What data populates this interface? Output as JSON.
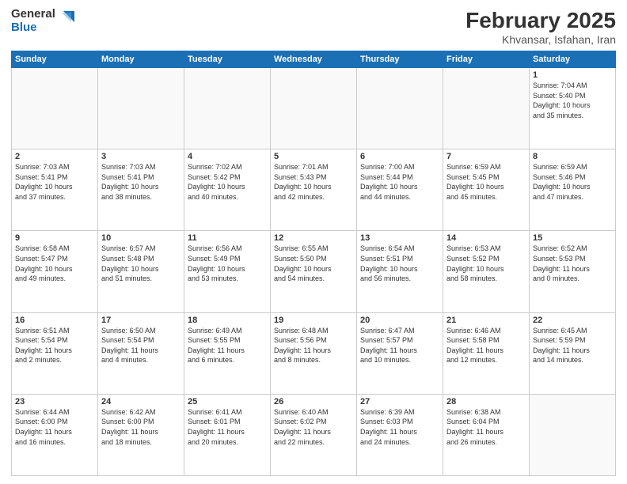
{
  "header": {
    "logo_line1": "General",
    "logo_line2": "Blue",
    "month": "February 2025",
    "location": "Khvansar, Isfahan, Iran"
  },
  "weekdays": [
    "Sunday",
    "Monday",
    "Tuesday",
    "Wednesday",
    "Thursday",
    "Friday",
    "Saturday"
  ],
  "weeks": [
    [
      {
        "day": "",
        "info": ""
      },
      {
        "day": "",
        "info": ""
      },
      {
        "day": "",
        "info": ""
      },
      {
        "day": "",
        "info": ""
      },
      {
        "day": "",
        "info": ""
      },
      {
        "day": "",
        "info": ""
      },
      {
        "day": "1",
        "info": "Sunrise: 7:04 AM\nSunset: 5:40 PM\nDaylight: 10 hours\nand 35 minutes."
      }
    ],
    [
      {
        "day": "2",
        "info": "Sunrise: 7:03 AM\nSunset: 5:41 PM\nDaylight: 10 hours\nand 37 minutes."
      },
      {
        "day": "3",
        "info": "Sunrise: 7:03 AM\nSunset: 5:41 PM\nDaylight: 10 hours\nand 38 minutes."
      },
      {
        "day": "4",
        "info": "Sunrise: 7:02 AM\nSunset: 5:42 PM\nDaylight: 10 hours\nand 40 minutes."
      },
      {
        "day": "5",
        "info": "Sunrise: 7:01 AM\nSunset: 5:43 PM\nDaylight: 10 hours\nand 42 minutes."
      },
      {
        "day": "6",
        "info": "Sunrise: 7:00 AM\nSunset: 5:44 PM\nDaylight: 10 hours\nand 44 minutes."
      },
      {
        "day": "7",
        "info": "Sunrise: 6:59 AM\nSunset: 5:45 PM\nDaylight: 10 hours\nand 45 minutes."
      },
      {
        "day": "8",
        "info": "Sunrise: 6:59 AM\nSunset: 5:46 PM\nDaylight: 10 hours\nand 47 minutes."
      }
    ],
    [
      {
        "day": "9",
        "info": "Sunrise: 6:58 AM\nSunset: 5:47 PM\nDaylight: 10 hours\nand 49 minutes."
      },
      {
        "day": "10",
        "info": "Sunrise: 6:57 AM\nSunset: 5:48 PM\nDaylight: 10 hours\nand 51 minutes."
      },
      {
        "day": "11",
        "info": "Sunrise: 6:56 AM\nSunset: 5:49 PM\nDaylight: 10 hours\nand 53 minutes."
      },
      {
        "day": "12",
        "info": "Sunrise: 6:55 AM\nSunset: 5:50 PM\nDaylight: 10 hours\nand 54 minutes."
      },
      {
        "day": "13",
        "info": "Sunrise: 6:54 AM\nSunset: 5:51 PM\nDaylight: 10 hours\nand 56 minutes."
      },
      {
        "day": "14",
        "info": "Sunrise: 6:53 AM\nSunset: 5:52 PM\nDaylight: 10 hours\nand 58 minutes."
      },
      {
        "day": "15",
        "info": "Sunrise: 6:52 AM\nSunset: 5:53 PM\nDaylight: 11 hours\nand 0 minutes."
      }
    ],
    [
      {
        "day": "16",
        "info": "Sunrise: 6:51 AM\nSunset: 5:54 PM\nDaylight: 11 hours\nand 2 minutes."
      },
      {
        "day": "17",
        "info": "Sunrise: 6:50 AM\nSunset: 5:54 PM\nDaylight: 11 hours\nand 4 minutes."
      },
      {
        "day": "18",
        "info": "Sunrise: 6:49 AM\nSunset: 5:55 PM\nDaylight: 11 hours\nand 6 minutes."
      },
      {
        "day": "19",
        "info": "Sunrise: 6:48 AM\nSunset: 5:56 PM\nDaylight: 11 hours\nand 8 minutes."
      },
      {
        "day": "20",
        "info": "Sunrise: 6:47 AM\nSunset: 5:57 PM\nDaylight: 11 hours\nand 10 minutes."
      },
      {
        "day": "21",
        "info": "Sunrise: 6:46 AM\nSunset: 5:58 PM\nDaylight: 11 hours\nand 12 minutes."
      },
      {
        "day": "22",
        "info": "Sunrise: 6:45 AM\nSunset: 5:59 PM\nDaylight: 11 hours\nand 14 minutes."
      }
    ],
    [
      {
        "day": "23",
        "info": "Sunrise: 6:44 AM\nSunset: 6:00 PM\nDaylight: 11 hours\nand 16 minutes."
      },
      {
        "day": "24",
        "info": "Sunrise: 6:42 AM\nSunset: 6:00 PM\nDaylight: 11 hours\nand 18 minutes."
      },
      {
        "day": "25",
        "info": "Sunrise: 6:41 AM\nSunset: 6:01 PM\nDaylight: 11 hours\nand 20 minutes."
      },
      {
        "day": "26",
        "info": "Sunrise: 6:40 AM\nSunset: 6:02 PM\nDaylight: 11 hours\nand 22 minutes."
      },
      {
        "day": "27",
        "info": "Sunrise: 6:39 AM\nSunset: 6:03 PM\nDaylight: 11 hours\nand 24 minutes."
      },
      {
        "day": "28",
        "info": "Sunrise: 6:38 AM\nSunset: 6:04 PM\nDaylight: 11 hours\nand 26 minutes."
      },
      {
        "day": "",
        "info": ""
      }
    ]
  ]
}
